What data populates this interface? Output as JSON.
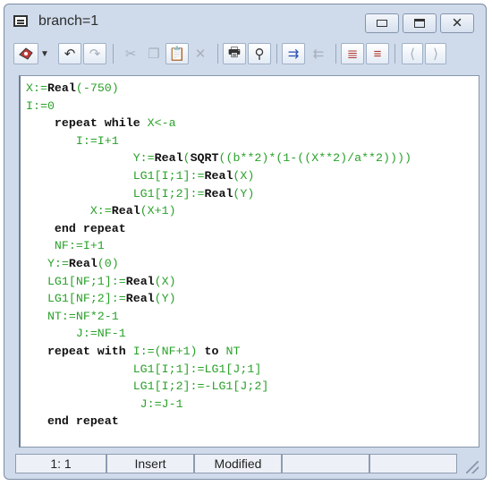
{
  "window": {
    "title": "branch=1"
  },
  "code_lines": [
    [
      [
        "X:=",
        "g"
      ],
      [
        "Real",
        "k"
      ],
      [
        "(-750)",
        "g"
      ]
    ],
    [
      [
        "I:=0",
        "g"
      ]
    ],
    [
      [
        "    ",
        "t"
      ],
      [
        "repeat while ",
        "k"
      ],
      [
        "X<-a",
        "g"
      ]
    ],
    [
      [
        "       ",
        "t"
      ],
      [
        "I:=I+1",
        "g"
      ]
    ],
    [
      [
        "               ",
        "t"
      ],
      [
        "Y:=",
        "g"
      ],
      [
        "Real",
        "k"
      ],
      [
        "(",
        "g"
      ],
      [
        "SQRT",
        "k"
      ],
      [
        "((b**2)*(1-((X**2)/a**2))))",
        "g"
      ]
    ],
    [
      [
        "               ",
        "t"
      ],
      [
        "LG1[I;1]:=",
        "g"
      ],
      [
        "Real",
        "k"
      ],
      [
        "(X)",
        "g"
      ]
    ],
    [
      [
        "               ",
        "t"
      ],
      [
        "LG1[I;2]:=",
        "g"
      ],
      [
        "Real",
        "k"
      ],
      [
        "(Y)",
        "g"
      ]
    ],
    [
      [
        "         ",
        "t"
      ],
      [
        "X:=",
        "g"
      ],
      [
        "Real",
        "k"
      ],
      [
        "(X+1)",
        "g"
      ]
    ],
    [
      [
        "    ",
        "t"
      ],
      [
        "end repeat",
        "k"
      ]
    ],
    [
      [
        "    ",
        "t"
      ],
      [
        "NF:=I+1",
        "g"
      ]
    ],
    [
      [
        "   ",
        "t"
      ],
      [
        "Y:=",
        "g"
      ],
      [
        "Real",
        "k"
      ],
      [
        "(0)",
        "g"
      ]
    ],
    [
      [
        "   ",
        "t"
      ],
      [
        "LG1[NF;1]:=",
        "g"
      ],
      [
        "Real",
        "k"
      ],
      [
        "(X)",
        "g"
      ]
    ],
    [
      [
        "   ",
        "t"
      ],
      [
        "LG1[NF;2]:=",
        "g"
      ],
      [
        "Real",
        "k"
      ],
      [
        "(Y)",
        "g"
      ]
    ],
    [
      [
        "   ",
        "t"
      ],
      [
        "NT:=NF*2-1",
        "g"
      ]
    ],
    [
      [
        "       ",
        "t"
      ],
      [
        "J:=NF-1",
        "g"
      ]
    ],
    [
      [
        "   ",
        "t"
      ],
      [
        "repeat with ",
        "k"
      ],
      [
        "I:=(NF+1)",
        "g"
      ],
      [
        " to ",
        "k"
      ],
      [
        "NT",
        "g"
      ]
    ],
    [
      [
        "               ",
        "t"
      ],
      [
        "LG1[I;1]:=LG1[J;1]",
        "g"
      ]
    ],
    [
      [
        "               ",
        "t"
      ],
      [
        "LG1[I;2]:=-LG1[J;2]",
        "g"
      ]
    ],
    [
      [
        "                ",
        "t"
      ],
      [
        "J:=J-1",
        "g"
      ]
    ],
    [
      [
        "   ",
        "t"
      ],
      [
        "end repeat",
        "k"
      ]
    ]
  ],
  "status": {
    "position": "1: 1",
    "mode": "Insert",
    "state": "Modified"
  },
  "toolbar_icons": [
    "paint-icon",
    "dropdown-arrow-icon",
    "undo-icon",
    "redo-icon",
    "cut-icon",
    "copy-icon",
    "paste-icon",
    "delete-icon",
    "print-icon",
    "find-replace-icon",
    "indent-icon",
    "unindent-icon",
    "comment-icon",
    "uncomment-icon",
    "bracket-left-icon",
    "bracket-right-icon"
  ],
  "colors": {
    "keyword": "#111111",
    "identifier": "#2aa12a",
    "chrome": "#cfdbeb"
  }
}
